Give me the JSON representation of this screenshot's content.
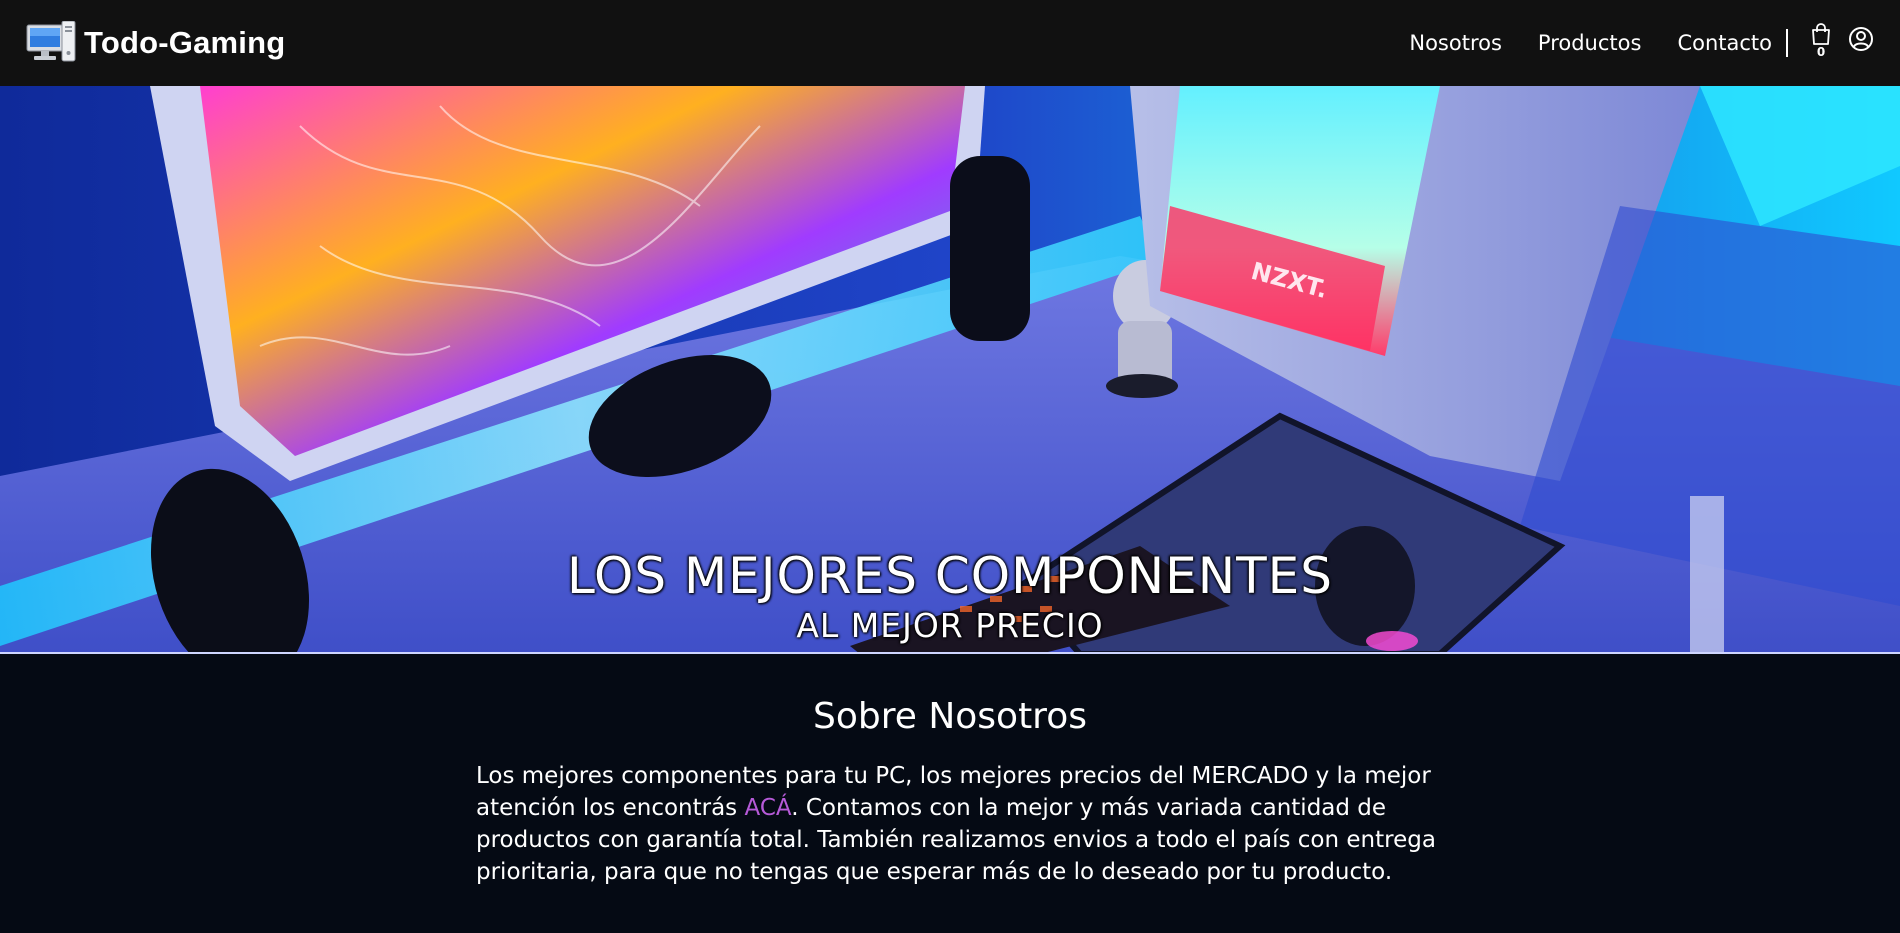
{
  "header": {
    "brand_name": "Todo-Gaming",
    "brand_icon": "computer-icon",
    "nav": {
      "nosotros": "Nosotros",
      "productos": "Productos",
      "contacto": "Contacto"
    },
    "cart_icon": "shopping-bag-icon",
    "cart_count": "0",
    "user_icon": "user-circle-icon"
  },
  "hero": {
    "title": "LOS MEJORES COMPONENTES",
    "subtitle": "AL MEJOR PRECIO",
    "image_label": "NZXT."
  },
  "about": {
    "title": "Sobre Nosotros",
    "text_before": "Los mejores componentes para tu PC, los mejores precios del MERCADO y la mejor atención los encontrás ",
    "link_text": "ACÁ",
    "text_after": ". Contamos con la mejor y más variada cantidad de productos con garantía total. También realizamos envios a todo el país con entrega prioritaria, para que no tengas que esperar más de lo deseado por tu producto.",
    "link_color": "#b65ad8"
  },
  "colors": {
    "navbar_bg": "#111111",
    "page_bg": "#050a14",
    "accent": "#b65ad8"
  }
}
